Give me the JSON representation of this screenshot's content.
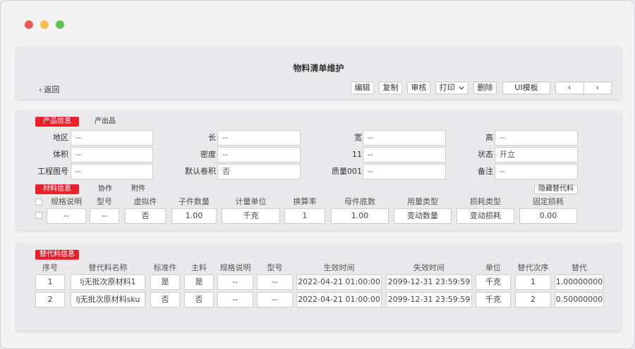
{
  "page": {
    "title": "物料清单维护"
  },
  "toolbar": {
    "back": "返回",
    "edit": "编辑",
    "copy": "复制",
    "review": "审核",
    "print": "打印",
    "delete": "删除",
    "ui_template": "UI模板",
    "prev": "‹",
    "next": "›"
  },
  "product": {
    "tab_active": "产品信息",
    "tab_other": "产出品",
    "fields": [
      {
        "label": "地区",
        "value": "--"
      },
      {
        "label": "长",
        "value": "--"
      },
      {
        "label": "宽",
        "value": "--"
      },
      {
        "label": "高",
        "value": "--"
      },
      {
        "label": "体积",
        "value": "--"
      },
      {
        "label": "密度",
        "value": "--"
      },
      {
        "label": "11",
        "value": "--"
      },
      {
        "label": "状态",
        "value": "开立"
      },
      {
        "label": "工程图号",
        "value": "--"
      },
      {
        "label": "默认卷积",
        "value": "否"
      },
      {
        "label": "质量001",
        "value": "--"
      },
      {
        "label": "备注",
        "value": "--"
      }
    ]
  },
  "material": {
    "tab_active": "材料信息",
    "tab_collab": "协作",
    "tab_attach": "附件",
    "hide_sub": "隐藏替代料",
    "headers": [
      "规格说明",
      "型号",
      "虚拟件",
      "子件数量",
      "计量单位",
      "换算率",
      "母件底数",
      "用量类型",
      "损耗类型",
      "固定损耗"
    ],
    "row": [
      "--",
      "--",
      "否",
      "1.00",
      "千克",
      "1",
      "1.00",
      "变动数量",
      "变动损耗",
      "0.00"
    ]
  },
  "substitute": {
    "tab": "替代料信息",
    "headers": [
      "序号",
      "替代料名称",
      "标准件",
      "主料",
      "规格说明",
      "型号",
      "生效时间",
      "失效时间",
      "单位",
      "替代次序",
      "替代"
    ],
    "rows": [
      [
        "1",
        "lj无批次原材料1",
        "是",
        "是",
        "--",
        "--",
        "2022-04-21  01:00:00",
        "2099-12-31 23:59:59",
        "千克",
        "1",
        "1.00000000"
      ],
      [
        "2",
        "lj无批次原材料sku",
        "否",
        "否",
        "--",
        "--",
        "2022-04-21  01:00:00",
        "2099-12-31 23:59:59",
        "千克",
        "2",
        "0.50000000"
      ]
    ]
  },
  "colors": {
    "accent": "#e8212d"
  }
}
